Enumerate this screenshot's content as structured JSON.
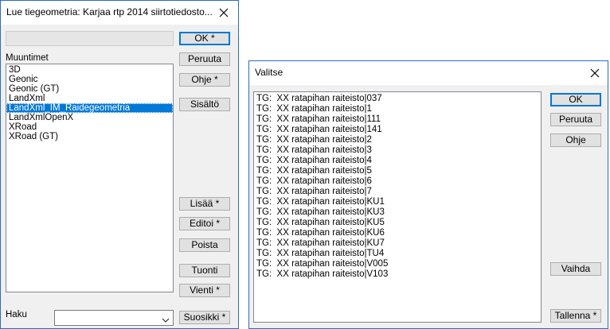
{
  "dialog1": {
    "title": "Lue tiegeometria: Karjaa rtp 2014 siirtotiedosto...",
    "path_value": "",
    "list_label": "Muuntimet",
    "items": [
      "3D",
      "Geonic",
      "Geonic (GT)",
      "LandXml",
      "LandXml_IM_Raidegeometria",
      "LandXmlOpenX",
      "XRoad",
      "XRoad (GT)"
    ],
    "selected_index": 4,
    "buttons": {
      "ok": "OK *",
      "cancel": "Peruuta",
      "help": "Ohje *",
      "contents": "Sisältö",
      "add": "Lisää *",
      "edit": "Editoi *",
      "delete": "Poista",
      "import": "Tuonti",
      "export": "Vienti *",
      "favorites": "Suosikki *"
    },
    "search_label": "Haku",
    "search_value": ""
  },
  "dialog2": {
    "title": "Valitse",
    "items": [
      "TG:  XX ratapihan raiteisto|037",
      "TG:  XX ratapihan raiteisto|1",
      "TG:  XX ratapihan raiteisto|111",
      "TG:  XX ratapihan raiteisto|141",
      "TG:  XX ratapihan raiteisto|2",
      "TG:  XX ratapihan raiteisto|3",
      "TG:  XX ratapihan raiteisto|4",
      "TG:  XX ratapihan raiteisto|5",
      "TG:  XX ratapihan raiteisto|6",
      "TG:  XX ratapihan raiteisto|7",
      "TG:  XX ratapihan raiteisto|KU1",
      "TG:  XX ratapihan raiteisto|KU3",
      "TG:  XX ratapihan raiteisto|KU5",
      "TG:  XX ratapihan raiteisto|KU6",
      "TG:  XX ratapihan raiteisto|KU7",
      "TG:  XX ratapihan raiteisto|TU4",
      "TG:  XX ratapihan raiteisto|V005",
      "TG:  XX ratapihan raiteisto|V103"
    ],
    "buttons": {
      "ok": "OK",
      "cancel": "Peruuta",
      "help": "Ohje",
      "switch": "Vaihda",
      "save": "Tallenna *"
    }
  },
  "icons": {
    "close": "close-icon",
    "dropdown": "chevron-down-icon"
  },
  "colors": {
    "accent": "#0078d7",
    "window_border": "#2b6cc4"
  }
}
